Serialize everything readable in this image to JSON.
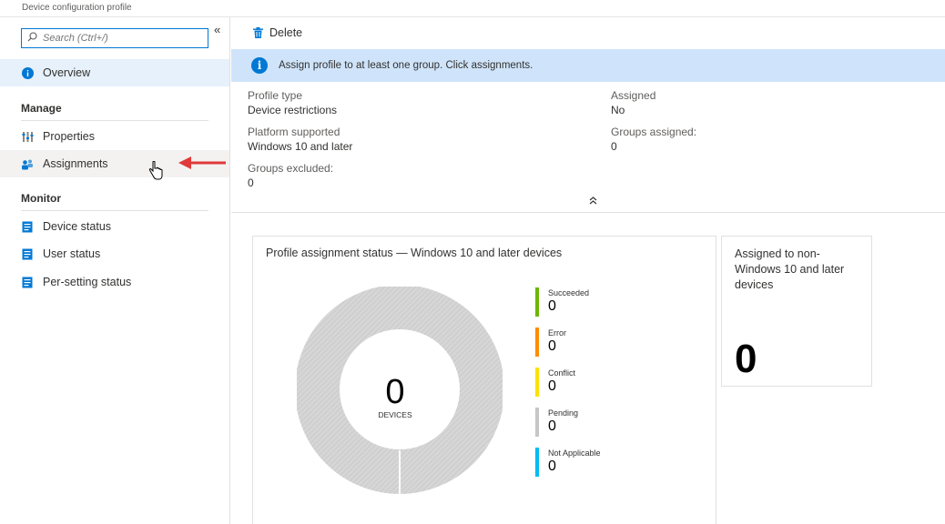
{
  "header": {
    "subtitle": "Device configuration profile"
  },
  "sidebar": {
    "search_placeholder": "Search (Ctrl+/)",
    "collapse_glyph": "«",
    "overview_label": "Overview",
    "manage_label": "Manage",
    "properties_label": "Properties",
    "assignments_label": "Assignments",
    "monitor_label": "Monitor",
    "device_status_label": "Device status",
    "user_status_label": "User status",
    "per_setting_status_label": "Per-setting status"
  },
  "toolbar": {
    "delete_label": "Delete"
  },
  "banner": {
    "text": "Assign profile to at least one group. Click assignments."
  },
  "properties": {
    "profile_type_label": "Profile type",
    "profile_type_value": "Device restrictions",
    "platform_label": "Platform supported",
    "platform_value": "Windows 10 and later",
    "groups_excluded_label": "Groups excluded:",
    "groups_excluded_value": "0",
    "assigned_label": "Assigned",
    "assigned_value": "No",
    "groups_assigned_label": "Groups assigned:",
    "groups_assigned_value": "0"
  },
  "status_tile": {
    "title": "Profile assignment status — Windows 10 and later devices",
    "center_value": "0",
    "center_label": "DEVICES",
    "legend": [
      {
        "label": "Succeeded",
        "value": "0",
        "color": "#6bb700"
      },
      {
        "label": "Error",
        "value": "0",
        "color": "#ff8c00"
      },
      {
        "label": "Conflict",
        "value": "0",
        "color": "#fce100"
      },
      {
        "label": "Pending",
        "value": "0",
        "color": "#c8c6c4"
      },
      {
        "label": "Not Applicable",
        "value": "0",
        "color": "#00bcf2"
      }
    ]
  },
  "non_win_tile": {
    "title": "Assigned to non-Windows 10 and later devices",
    "value": "0"
  },
  "colors": {
    "accent": "#0078d4",
    "banner_bg": "#cfe4fa",
    "annotation_arrow": "#e03a3a"
  }
}
